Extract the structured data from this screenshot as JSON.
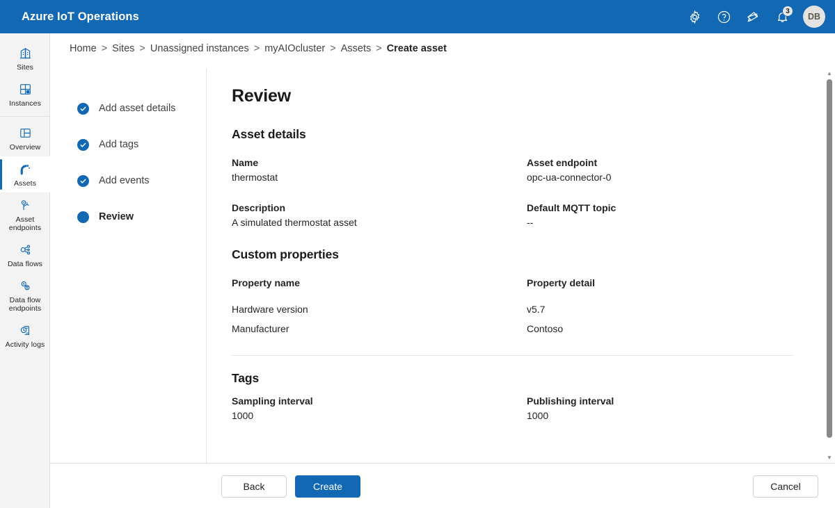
{
  "header": {
    "brand": "Azure IoT Operations",
    "icons": [
      {
        "name": "gear-icon",
        "label": "Settings"
      },
      {
        "name": "help-icon",
        "label": "Help"
      },
      {
        "name": "feedback-icon",
        "label": "Feedback"
      }
    ],
    "notifications": {
      "icon": "bell-icon",
      "count": "3"
    },
    "avatar": {
      "initials": "DB"
    },
    "background_color": "#1268b3"
  },
  "sidebar": {
    "items": [
      {
        "label": "Sites",
        "icon": "sites-icon",
        "active": false
      },
      {
        "label": "Instances",
        "icon": "instances-icon",
        "active": false
      },
      {
        "label": "Overview",
        "icon": "overview-icon",
        "active": false
      },
      {
        "label": "Assets",
        "icon": "assets-icon",
        "active": true
      },
      {
        "label": "Asset endpoints",
        "icon": "asset-endpoints-icon",
        "active": false
      },
      {
        "label": "Data flows",
        "icon": "data-flows-icon",
        "active": false
      },
      {
        "label": "Data flow endpoints",
        "icon": "data-flow-endpoints-icon",
        "active": false
      },
      {
        "label": "Activity logs",
        "icon": "activity-logs-icon",
        "active": false
      }
    ]
  },
  "breadcrumb": {
    "separator": ">",
    "items": [
      "Home",
      "Sites",
      "Unassigned instances",
      "myAIOcluster",
      "Assets"
    ],
    "current": "Create asset"
  },
  "wizard": {
    "steps": [
      {
        "label": "Add asset details",
        "state": "completed"
      },
      {
        "label": "Add tags",
        "state": "completed"
      },
      {
        "label": "Add events",
        "state": "completed"
      },
      {
        "label": "Review",
        "state": "current"
      }
    ]
  },
  "main": {
    "title": "Review",
    "asset_details": {
      "heading": "Asset details",
      "fields": [
        {
          "label": "Name",
          "value": "thermostat"
        },
        {
          "label": "Asset endpoint",
          "value": "opc-ua-connector-0"
        },
        {
          "label": "Description",
          "value": "A simulated thermostat asset"
        },
        {
          "label": "Default MQTT topic",
          "value": "--"
        }
      ]
    },
    "custom_properties": {
      "heading": "Custom properties",
      "columns": [
        "Property name",
        "Property detail"
      ],
      "rows": [
        [
          "Hardware version",
          "v5.7"
        ],
        [
          "Manufacturer",
          "Contoso"
        ]
      ]
    },
    "tags": {
      "heading": "Tags",
      "fields": [
        {
          "label": "Sampling interval",
          "value": "1000"
        },
        {
          "label": "Publishing interval",
          "value": "1000"
        }
      ]
    }
  },
  "footer": {
    "back_label": "Back",
    "create_label": "Create",
    "cancel_label": "Cancel",
    "primary_color": "#1268b3"
  },
  "scrollbar": {
    "up_arrow": "▲",
    "down_arrow": "▼"
  }
}
